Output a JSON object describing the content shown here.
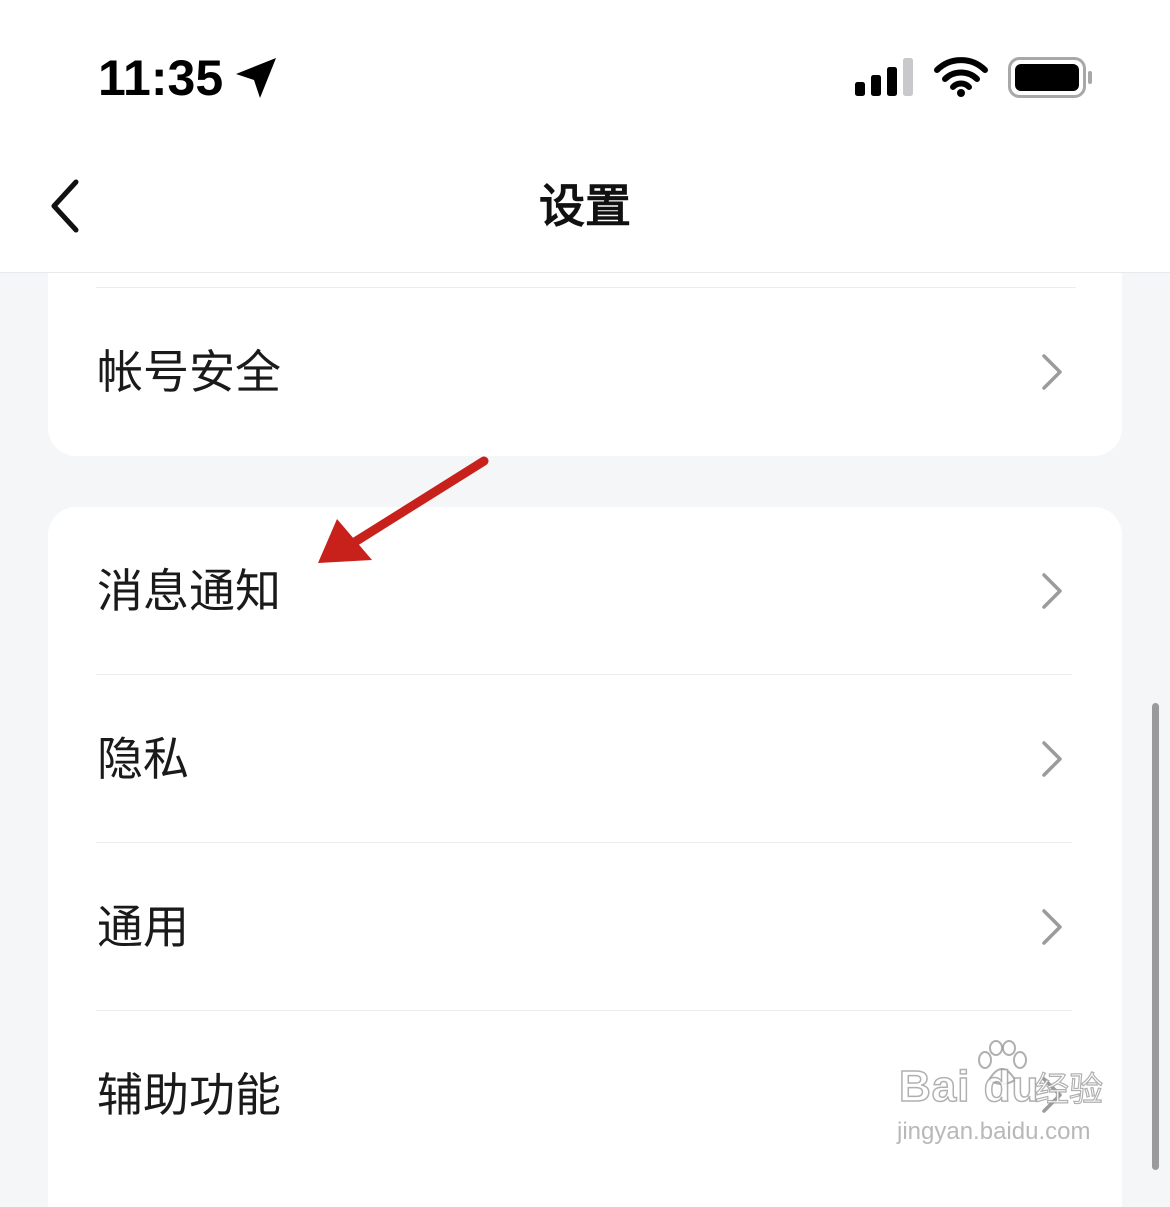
{
  "status_bar": {
    "time": "11:35",
    "icons": [
      "location-arrow-icon",
      "cellular-signal-icon",
      "wifi-icon",
      "battery-icon"
    ]
  },
  "nav": {
    "title": "设置",
    "back_icon": "chevron-left-icon"
  },
  "settings": {
    "account_section": {
      "items": [
        {
          "label": "帐号安全"
        }
      ]
    },
    "main_section": {
      "items": [
        {
          "label": "消息通知"
        },
        {
          "label": "隐私"
        },
        {
          "label": "通用"
        },
        {
          "label": "辅助功能"
        }
      ]
    }
  },
  "annotation": {
    "type": "arrow",
    "color": "#c8201a",
    "target": "消息通知"
  },
  "watermark": {
    "logo_text": "Bai du",
    "brand_text": "经验",
    "url": "jingyan.baidu.com"
  },
  "colors": {
    "background": "#f5f6f8",
    "card": "#ffffff",
    "text": "#1a1a1a",
    "chevron": "#9b9b9b"
  }
}
